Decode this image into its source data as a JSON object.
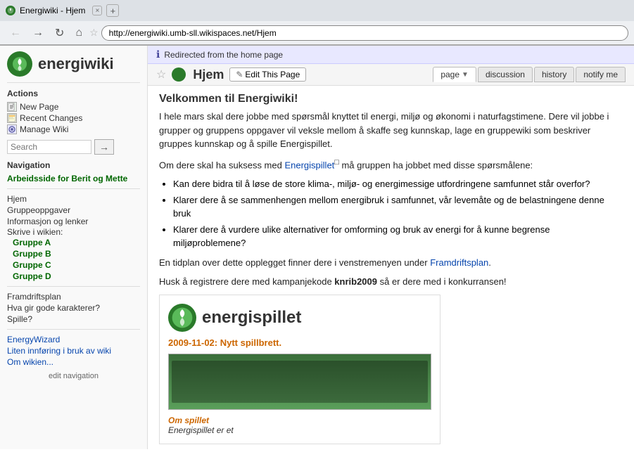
{
  "browser": {
    "tab_title": "Energiwiki - Hjem",
    "url": "http://energiwiki.umb-sll.wikispaces.net/Hjem",
    "new_tab_symbol": "+",
    "back_symbol": "←",
    "forward_symbol": "→",
    "refresh_symbol": "↻",
    "home_symbol": "⌂",
    "star_symbol": "★"
  },
  "sidebar": {
    "logo_text": "energiwiki",
    "actions_title": "Actions",
    "actions": [
      {
        "label": "New Page",
        "icon": "new-icon"
      },
      {
        "label": "Recent Changes",
        "icon": "changes-icon"
      },
      {
        "label": "Manage Wiki",
        "icon": "manage-icon"
      }
    ],
    "search_placeholder": "Search",
    "search_btn_symbol": "→",
    "navigation_title": "Navigation",
    "nav_links": [
      {
        "label": "Arbeidsside for Berit og Mette",
        "type": "green-link"
      }
    ],
    "nav_items": [
      {
        "label": "Hjem",
        "type": "plain"
      },
      {
        "label": "Gruppeoppgaver",
        "type": "plain"
      },
      {
        "label": "Informasjon og lenker",
        "type": "plain"
      },
      {
        "label": "Skrive i wikien:",
        "type": "label"
      },
      {
        "label": "Gruppe A",
        "type": "green",
        "indented": true
      },
      {
        "label": "Gruppe B",
        "type": "green",
        "indented": true
      },
      {
        "label": "Gruppe C",
        "type": "green",
        "indented": true
      },
      {
        "label": "Gruppe D",
        "type": "green",
        "indented": true
      }
    ],
    "nav_items2": [
      {
        "label": "Framdriftsplan",
        "type": "plain"
      },
      {
        "label": "Hva gir gode karakterer?",
        "type": "plain"
      },
      {
        "label": "Spille?",
        "type": "plain"
      }
    ],
    "nav_items3": [
      {
        "label": "EnergyWizard",
        "type": "link"
      },
      {
        "label": "Liten innføring i bruk av wiki",
        "type": "link"
      },
      {
        "label": "Om wikien...",
        "type": "link"
      }
    ],
    "edit_nav_label": "edit navigation"
  },
  "main": {
    "redirect_text": "Redirected from the home page",
    "redirect_icon": "ℹ",
    "page_title": "Hjem",
    "star_symbol": "☆",
    "edit_btn_label": "Edit This Page",
    "edit_pencil": "✎",
    "tabs": [
      {
        "label": "page",
        "dropdown": true,
        "active": true
      },
      {
        "label": "discussion",
        "active": false
      },
      {
        "label": "history",
        "active": false
      },
      {
        "label": "notify me",
        "active": false
      }
    ],
    "content": {
      "heading": "Velkommen til Energiwiki!",
      "paragraph1": "I hele mars skal dere jobbe med spørsmål knyttet til energi, miljø og økonomi i naturfagstimene. Dere vil jobbe i grupper og gruppens oppgaver vil veksle mellom å skaffe seg kunnskap, lage en gruppewiki som beskriver gruppes kunnskap og å spille Energispillet.",
      "paragraph2_prefix": "Om dere skal ha suksess med ",
      "paragraph2_link": "Energispillet",
      "paragraph2_suffix": " må gruppen ha jobbet med disse spørsmålene:",
      "bullets": [
        "Kan dere bidra til å løse de store klima-, miljø- og energimessige utfordringene samfunnet står overfor?",
        "Klarer dere å se sammenhengen mellom energibruk i samfunnet, vår levemåte og de belastningene denne bruk",
        "Klarer dere å vurdere ulike alternativer for omforming og bruk av energi for å kunne begrense miljøproblemene?"
      ],
      "paragraph3_prefix": "En tidplan over dette opplegget finner dere i venstremenyen under ",
      "paragraph3_link": "Framdriftsplan",
      "paragraph3_suffix": ".",
      "red_text_prefix": "Husk å registrere dere med kampanjekode ",
      "red_text_bold": "knrib2009",
      "red_text_suffix": " så er dere med i konkurransen!",
      "image_logo": "energispillet",
      "image_subtitle": "2009-11-02: Nytt spillbrett.",
      "image_footer_title": "Om spillet",
      "image_footer_text": "Energispillet er et"
    }
  }
}
